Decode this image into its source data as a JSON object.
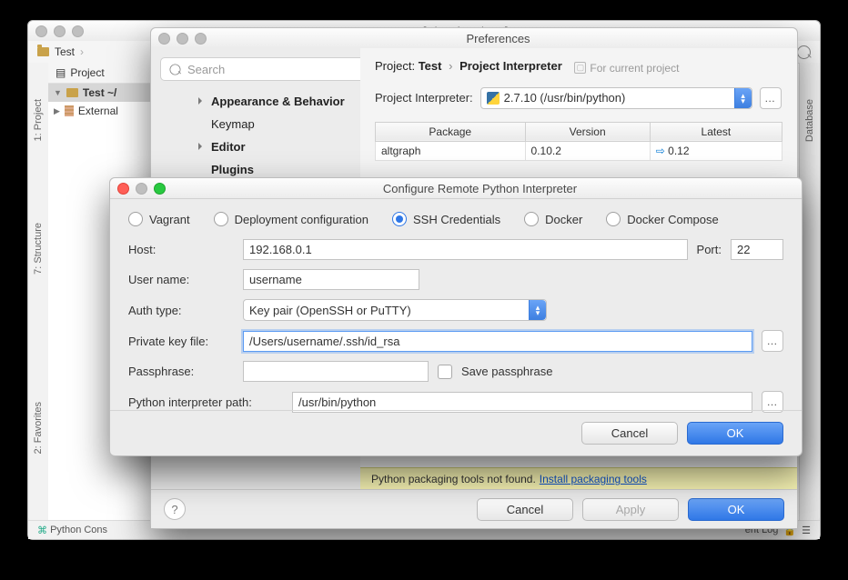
{
  "ide": {
    "title": "Test – [~/Desktop/Test]",
    "breadcrumb": "Test",
    "gutter": {
      "project": "1: Project",
      "structure": "7: Structure",
      "favorites": "2: Favorites",
      "database": "Database"
    },
    "projectTool": "Project",
    "tree": {
      "root": "Test ~/",
      "ext": "External"
    },
    "status": {
      "left": "Python Cons",
      "right": "ent Log"
    }
  },
  "prefs": {
    "title": "Preferences",
    "search_placeholder": "Search",
    "categories": [
      "Appearance & Behavior",
      "Keymap",
      "Editor",
      "Plugins"
    ],
    "category_bold": [
      true,
      false,
      true,
      true
    ],
    "category_disclosure": [
      true,
      false,
      true,
      false
    ],
    "crumb_prefix": "Project:",
    "crumb_project": "Test",
    "crumb_page": "Project Interpreter",
    "hint": "For current project",
    "row_label": "Project Interpreter:",
    "interpreter_text": "2.7.10 (/usr/bin/python)",
    "table_headers": [
      "Package",
      "Version",
      "Latest"
    ],
    "pkg": {
      "name": "altgraph",
      "version": "0.10.2",
      "latest": "0.12"
    },
    "warn_text": "Python packaging tools not found.",
    "warn_link": "Install packaging tools",
    "buttons": {
      "cancel": "Cancel",
      "apply": "Apply",
      "ok": "OK"
    }
  },
  "cfg": {
    "title": "Configure Remote Python Interpreter",
    "radios": [
      "Vagrant",
      "Deployment configuration",
      "SSH Credentials",
      "Docker",
      "Docker Compose"
    ],
    "selected_radio": 2,
    "labels": {
      "host": "Host:",
      "port": "Port:",
      "user": "User name:",
      "auth": "Auth type:",
      "key": "Private key file:",
      "pass": "Passphrase:",
      "save": "Save passphrase",
      "pypath": "Python interpreter path:"
    },
    "values": {
      "host": "192.168.0.1",
      "port": "22",
      "user": "username",
      "auth": "Key pair (OpenSSH or PuTTY)",
      "key": "/Users/username/.ssh/id_rsa",
      "pass": "",
      "pypath": "/usr/bin/python"
    },
    "buttons": {
      "cancel": "Cancel",
      "ok": "OK"
    }
  }
}
